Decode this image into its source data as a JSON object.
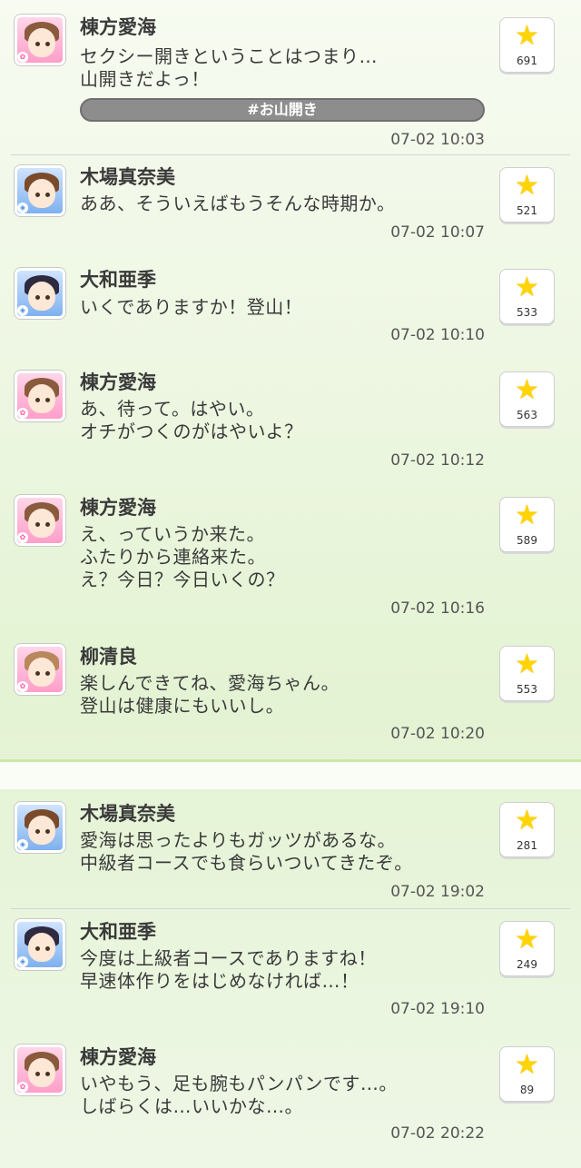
{
  "threads": [
    {
      "posts": [
        {
          "name": "棟方愛海",
          "text": "セクシー開きということはつまり…\n山開きだよっ！",
          "hashtag": "#お山開き",
          "time": "07-02 10:03",
          "likes": "691",
          "attribute": "cute"
        },
        {
          "name": "木場真奈美",
          "text": "ああ、そういえばもうそんな時期か。",
          "time": "07-02 10:07",
          "likes": "521",
          "attribute": "cool"
        },
        {
          "name": "大和亜季",
          "text": "いくでありますか！登山！",
          "time": "07-02 10:10",
          "likes": "533",
          "attribute": "cool"
        },
        {
          "name": "棟方愛海",
          "text": "あ、待って。はやい。\nオチがつくのがはやいよ？",
          "time": "07-02 10:12",
          "likes": "563",
          "attribute": "cute"
        },
        {
          "name": "棟方愛海",
          "text": "え、っていうか来た。\nふたりから連絡来た。\nえ？今日？今日いくの？",
          "time": "07-02 10:16",
          "likes": "589",
          "attribute": "cute"
        },
        {
          "name": "柳清良",
          "text": "楽しんできてね、愛海ちゃん。\n登山は健康にもいいし。",
          "time": "07-02 10:20",
          "likes": "553",
          "attribute": "cute"
        }
      ]
    },
    {
      "posts": [
        {
          "name": "木場真奈美",
          "text": "愛海は思ったよりもガッツがあるな。\n中級者コースでも食らいついてきたぞ。",
          "time": "07-02 19:02",
          "likes": "281",
          "attribute": "cool"
        },
        {
          "name": "大和亜季",
          "text": "今度は上級者コースでありますね！\n早速体作りをはじめなければ…！",
          "time": "07-02 19:10",
          "likes": "249",
          "attribute": "cool"
        },
        {
          "name": "棟方愛海",
          "text": "いやもう、足も腕もパンパンです…。\nしばらくは…いいかな…。",
          "time": "07-02 20:22",
          "likes": "89",
          "attribute": "cute"
        }
      ]
    }
  ],
  "icons": {
    "like": "star-icon",
    "attribute_cute": "flower-icon",
    "attribute_cool": "diamond-icon"
  },
  "colors": {
    "star": "#ffd400",
    "cute": "#ff7ab8",
    "cool": "#5a9be8",
    "hashtag_bg": "#8d8d8d",
    "band": "#c9e8a4"
  }
}
